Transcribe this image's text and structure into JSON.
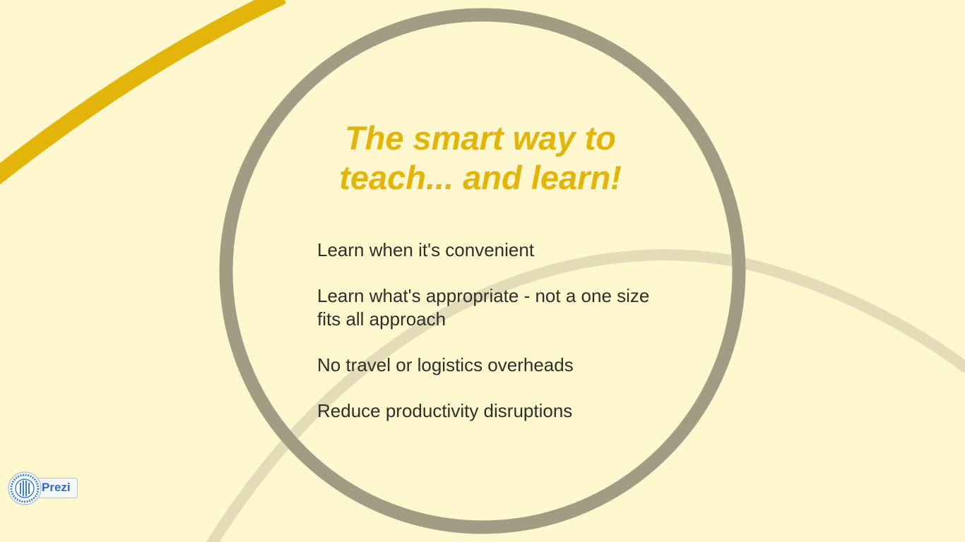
{
  "slide": {
    "title_line1": "The smart way to",
    "title_line2": "teach... and learn!",
    "bullets": [
      "Learn when it's convenient",
      "Learn what's appropriate - not a one size fits all approach",
      "No travel or logistics overheads",
      "Reduce productivity disruptions"
    ]
  },
  "brand": {
    "label": "Prezi",
    "icon": "prezi-logo-icon"
  },
  "colors": {
    "background": "#fff8cf",
    "title": "#e3b50b",
    "body_text": "#2e2e2a",
    "ring": "#a29c84",
    "accent_arc": "#e3b50b",
    "faint_arc": "#e4dcb8",
    "brand_blue": "#2d6cc0"
  }
}
